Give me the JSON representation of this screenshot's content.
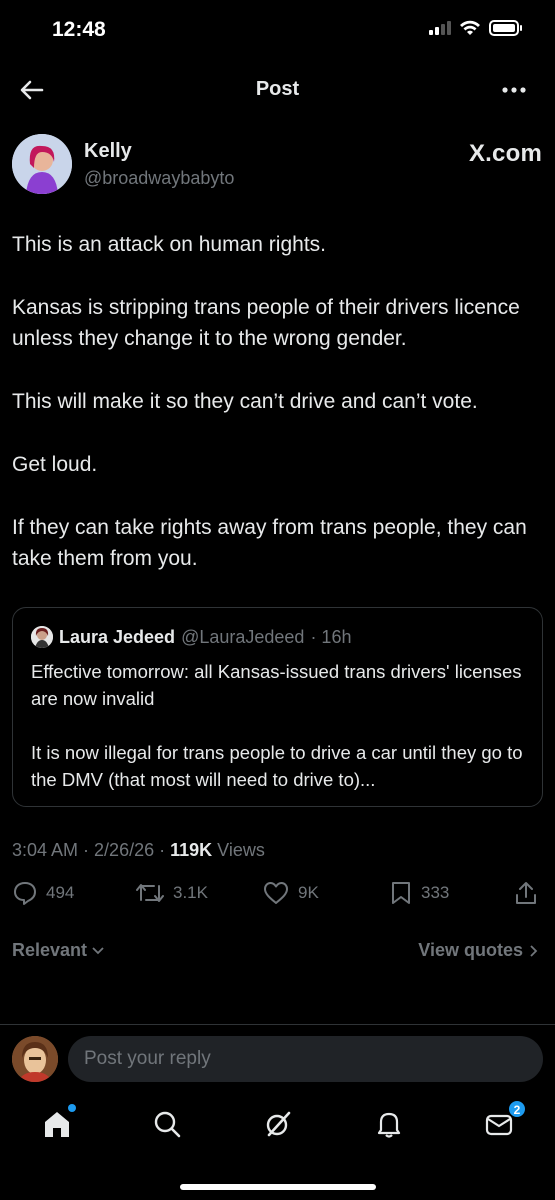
{
  "status_bar": {
    "time": "12:48"
  },
  "header": {
    "title": "Post"
  },
  "author": {
    "name": "Kelly",
    "handle": "@broadwaybabyto"
  },
  "watermark": "X.com",
  "post": {
    "paragraphs": [
      "This is an attack on human rights.",
      "Kansas is stripping trans people of their drivers licence unless they change it to the wrong gender.",
      "This will make it so they can’t drive and can’t vote.",
      "Get loud.",
      "If they can take rights away from trans people, they can take them from you."
    ]
  },
  "quote": {
    "name": "Laura Jedeed",
    "handle": "@LauraJedeed",
    "time": "· 16h",
    "paragraphs": [
      "Effective tomorrow: all Kansas-issued trans drivers' licenses are now invalid",
      "It is now illegal for trans people to drive a car until they go to the DMV (that most will need to drive to)..."
    ]
  },
  "meta": {
    "time": "3:04 AM",
    "date": "2/26/26",
    "views_count": "119K",
    "views_label": "Views"
  },
  "actions": {
    "replies": "494",
    "reposts": "3.1K",
    "likes": "9K",
    "bookmarks": "333"
  },
  "filter": {
    "label": "Relevant"
  },
  "view_quotes": {
    "label": "View quotes"
  },
  "reply": {
    "placeholder": "Post your reply"
  },
  "tabbar": {
    "messages_badge": "2"
  },
  "icons": [
    "back-arrow-icon",
    "more-icon",
    "reply-icon",
    "repost-icon",
    "like-icon",
    "bookmark-icon",
    "share-icon",
    "home-icon",
    "search-icon",
    "grok-icon",
    "notifications-icon",
    "messages-icon"
  ],
  "colors": {
    "background": "#000000",
    "text": "#e7e9ea",
    "secondary": "#71767b",
    "accent": "#1d9bf0",
    "border": "#2f3336"
  }
}
